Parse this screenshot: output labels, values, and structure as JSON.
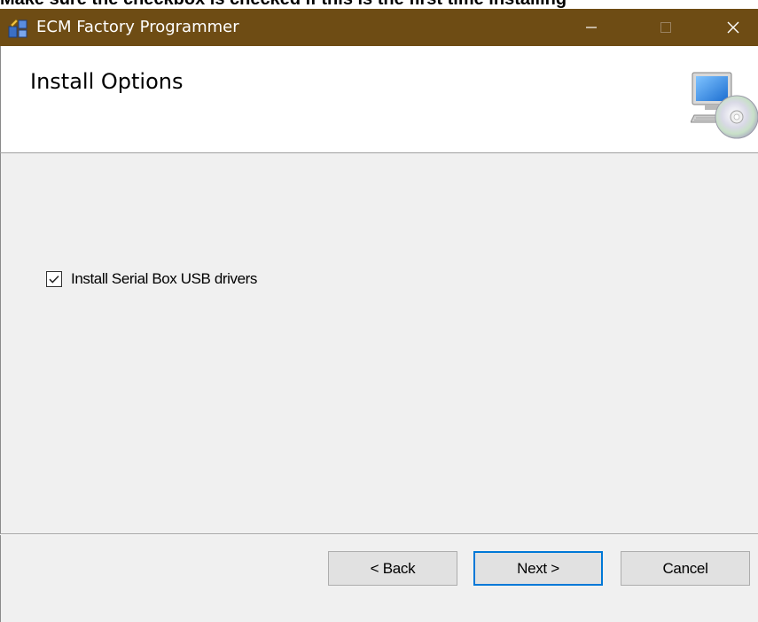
{
  "caption": "Make sure the checkbox is checked if this is the first time installing",
  "window": {
    "title": "ECM Factory Programmer",
    "controls": {
      "minimize": "—",
      "maximize": "☐",
      "close": "✕"
    }
  },
  "header": {
    "title": "Install Options",
    "icon": "computer-cd-icon"
  },
  "options": {
    "serial_usb": {
      "label": "Install Serial Box USB drivers",
      "checked": true
    }
  },
  "buttons": {
    "back": "< Back",
    "next": "Next >",
    "cancel": "Cancel"
  },
  "colors": {
    "titlebar": "#6e4c14",
    "body": "#f0f0f0",
    "accent": "#0078d7"
  }
}
